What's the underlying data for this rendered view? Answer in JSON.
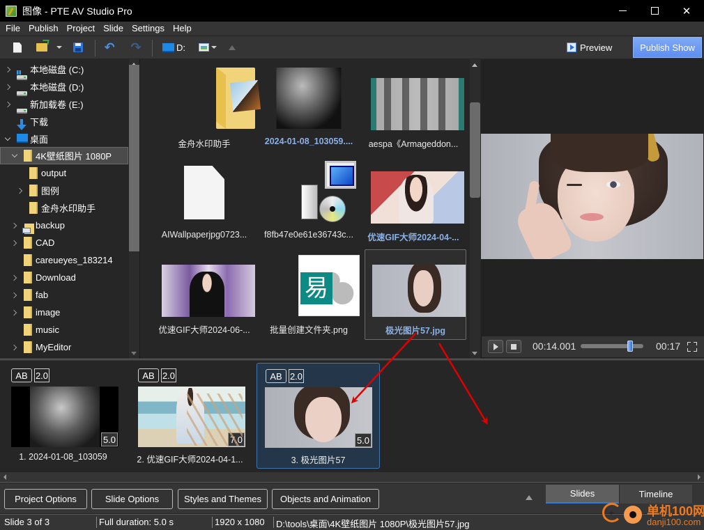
{
  "window": {
    "title": "图像 - PTE AV Studio Pro",
    "controls": [
      "minimize",
      "maximize",
      "close"
    ]
  },
  "menu": [
    "File",
    "Publish",
    "Project",
    "Slide",
    "Settings",
    "Help"
  ],
  "toolbar": {
    "drive_label": "D:",
    "preview_label": "Preview",
    "publish_label": "Publish Show",
    "icons": [
      "new-document-icon",
      "open-folder-icon",
      "dropdown-icon",
      "save-icon",
      "undo-icon",
      "redo-icon",
      "drive-icon",
      "view-mode-icon",
      "up-folder-icon"
    ]
  },
  "tree": {
    "items": [
      {
        "label": "本地磁盘 (C:)",
        "icon": "system-drive-icon",
        "expander": "collapsed",
        "level": 0
      },
      {
        "label": "本地磁盘 (D:)",
        "icon": "drive-icon",
        "expander": "collapsed",
        "level": 0
      },
      {
        "label": "新加载卷 (E:)",
        "icon": "drive-icon",
        "expander": "collapsed",
        "level": 0
      },
      {
        "label": "下载",
        "icon": "download-icon",
        "expander": "none",
        "level": 0
      },
      {
        "label": "桌面",
        "icon": "desktop-icon",
        "expander": "expanded",
        "level": 0
      },
      {
        "label": "4K壁纸图片 1080P",
        "icon": "folder-icon",
        "expander": "expanded",
        "level": 1,
        "selected": true
      },
      {
        "label": "output",
        "icon": "folder-icon",
        "expander": "none",
        "level": 2
      },
      {
        "label": "图例",
        "icon": "folder-icon",
        "expander": "collapsed",
        "level": 2
      },
      {
        "label": "金舟水印助手",
        "icon": "folder-icon",
        "expander": "none",
        "level": 2
      },
      {
        "label": "backup",
        "icon": "network-folder-icon",
        "expander": "collapsed",
        "level": 1
      },
      {
        "label": "CAD",
        "icon": "folder-icon",
        "expander": "collapsed",
        "level": 1
      },
      {
        "label": "careueyes_183214",
        "icon": "folder-icon",
        "expander": "none",
        "level": 1
      },
      {
        "label": "Download",
        "icon": "folder-icon",
        "expander": "collapsed",
        "level": 1
      },
      {
        "label": "fab",
        "icon": "folder-icon",
        "expander": "collapsed",
        "level": 1
      },
      {
        "label": "image",
        "icon": "folder-icon",
        "expander": "collapsed",
        "level": 1
      },
      {
        "label": "music",
        "icon": "folder-icon",
        "expander": "none",
        "level": 1
      },
      {
        "label": "MyEditor",
        "icon": "folder-icon",
        "expander": "collapsed",
        "level": 1
      }
    ]
  },
  "files": [
    {
      "label": "金舟水印助手",
      "thumb": "folder-thumbnail",
      "highlight": false
    },
    {
      "label": "2024-01-08_103059....",
      "thumb": "bw-landscape-thumbnail",
      "highlight": true
    },
    {
      "label": "aespa《Armageddon...",
      "thumb": "video-filmstrip-thumbnail",
      "highlight": false
    },
    {
      "label": "AIWallpaperjpg0723...",
      "thumb": "blank-document-thumbnail",
      "highlight": false
    },
    {
      "label": "f8fb47e0e61e36743c...",
      "thumb": "installer-thumbnail",
      "highlight": false
    },
    {
      "label": "优速GIF大师2024-04-...",
      "thumb": "gif-portrait-thumbnail",
      "highlight": true
    },
    {
      "label": "优速GIF大师2024-06-...",
      "thumb": "stage-performance-thumbnail",
      "highlight": false
    },
    {
      "label": "批量创建文件夹.png",
      "thumb": "logo-thumbnail",
      "highlight": false
    },
    {
      "label": "极光图片57.jpg",
      "thumb": "portrait-thumbnail",
      "highlight": true,
      "selected": true
    }
  ],
  "player": {
    "current_time": "00:14.001",
    "total_time": "00:17",
    "position_fraction": 0.82
  },
  "slides": [
    {
      "label": "1. 2024-01-08_103059",
      "transition_badge": "AB",
      "transition_duration": "2.0",
      "duration": "5.0",
      "thumb": "bw-landscape",
      "selected": false
    },
    {
      "label": "2. 优速GIF大师2024-04-1...",
      "transition_badge": "AB",
      "transition_duration": "2.0",
      "duration": "7.0",
      "thumb": "beach-girl",
      "selected": false
    },
    {
      "label": "3. 极光图片57",
      "transition_badge": "AB",
      "transition_duration": "2.0",
      "duration": "5.0",
      "thumb": "portrait",
      "selected": true
    }
  ],
  "bottom_buttons": [
    "Project Options",
    "Slide Options",
    "Styles and Themes",
    "Objects and Animation"
  ],
  "view_tabs": [
    {
      "label": "Slides",
      "active": true
    },
    {
      "label": "Timeline",
      "active": false
    }
  ],
  "status": {
    "slide": "Slide 3 of 3",
    "duration": "Full duration: 5.0 s",
    "resolution": "1920 x 1080",
    "path": "D:\\tools\\桌面\\4K壁纸图片 1080P\\极光图片57.jpg"
  },
  "watermark": {
    "cn": "单机100网",
    "en": "danji100.com"
  },
  "colors": {
    "accent_blue": "#2a7de1",
    "publish_button": "#6a98f2",
    "selected_slide_bg": "#243649",
    "annotation_red": "#e00000"
  }
}
